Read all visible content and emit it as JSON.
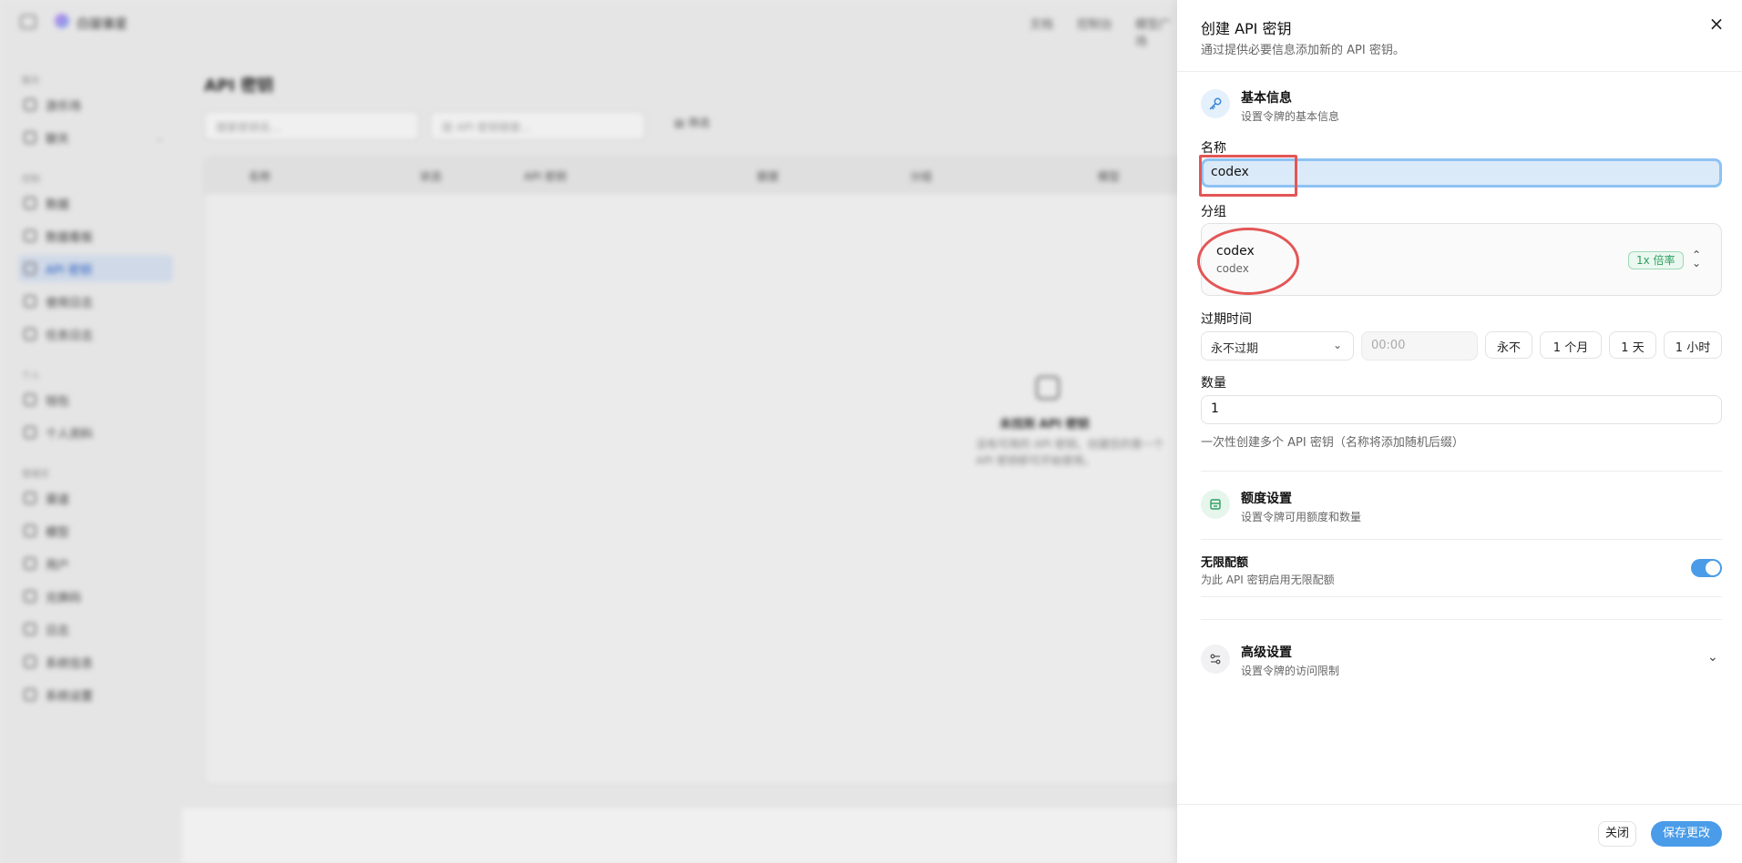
{
  "background": {
    "brand_name": "白骏骓星",
    "top_nav": [
      "文档",
      "控制台",
      "模型广场"
    ],
    "sidebar": {
      "sections": [
        "聊天",
        "控制",
        "个人",
        "管理员"
      ],
      "items": [
        "游乐场",
        "聊天",
        "数据",
        "数据看板",
        "API 密钥",
        "使用日志",
        "任务日志",
        "钱包",
        "个人资料",
        "渠道",
        "模型",
        "用户",
        "兑换码",
        "日志",
        "系统信息",
        "系统设置"
      ]
    },
    "page_title": "API 密钥",
    "filters": [
      "搜索密钥名...",
      "按 API 密钥搜索..."
    ],
    "filter_button": "筛选",
    "table_headers": [
      "名称",
      "状态",
      "API 密钥",
      "额度",
      "分组",
      "模型"
    ],
    "empty_title": "未找到 API 密钥",
    "empty_desc": "没有可用的 API 密钥。创建您的第一个 API 密钥即可开始使用。"
  },
  "drawer": {
    "title": "创建 API 密钥",
    "subtitle": "通过提供必要信息添加新的 API 密钥。",
    "close_icon": "×",
    "basic": {
      "title": "基本信息",
      "subtitle": "设置令牌的基本信息"
    },
    "name_label": "名称",
    "name_value": "codex",
    "group_label": "分组",
    "group": {
      "name": "codex",
      "desc": "codex",
      "ratio": "1x 倍率"
    },
    "expiry_label": "过期时间",
    "expiry_select": "永不过期",
    "expiry_time_placeholder": "00:00",
    "expiry_presets": [
      "永不",
      "1 个月",
      "1 天",
      "1 小时"
    ],
    "count_label": "数量",
    "count_value": "1",
    "count_helper": "一次性创建多个 API 密钥（名称将添加随机后缀）",
    "quota": {
      "title": "额度设置",
      "subtitle": "设置令牌可用额度和数量"
    },
    "unlimited": {
      "title": "无限配额",
      "subtitle": "为此 API 密钥启用无限配额",
      "enabled": true
    },
    "advanced": {
      "title": "高级设置",
      "subtitle": "设置令牌的访问限制"
    },
    "footer": {
      "close": "关闭",
      "save": "保存更改"
    }
  },
  "colors": {
    "accent": "#4a9ce8",
    "annotation": "#e35656",
    "badge_green": "#2e9e5f"
  }
}
